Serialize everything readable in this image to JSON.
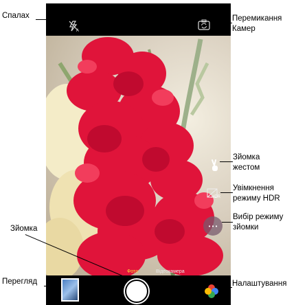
{
  "labels": {
    "flash": "Спалах",
    "switch_cam_1": "Перемикання",
    "switch_cam_2": "Камер",
    "gesture_1": "Зйомка",
    "gesture_2": "жестом",
    "hdr_1": "Увімкнення",
    "hdr_2": "режиму HDR",
    "mode_1": "Вибір режиму",
    "mode_2": "зйомки",
    "shoot": "Зйомка",
    "preview": "Перегляд",
    "settings": "Налаштування"
  },
  "camera": {
    "hdr_text": "HDR",
    "mode_photo": "Фото",
    "mode_video": "Відеокамера",
    "mode_dots": "• • •"
  },
  "icons": {
    "flash": "flash-auto-icon",
    "switch": "switch-camera-icon",
    "gesture": "v-gesture-icon",
    "hdr": "hdr-icon",
    "settings": "google-photos-pinwheel-icon"
  }
}
